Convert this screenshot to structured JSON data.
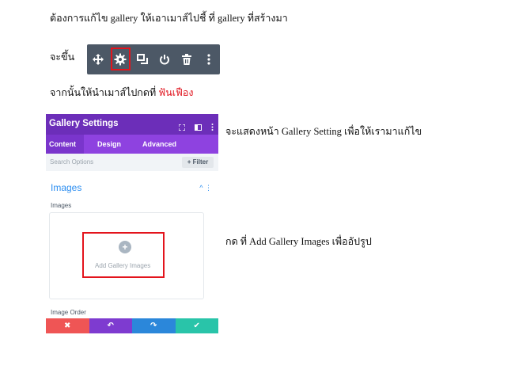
{
  "doc": {
    "line1": "ต้องการแก้ไข gallery ให้เอาเมาส์ไปชี้ ที่ gallery ที่สร้างมา",
    "line2": "จะขึ้น",
    "line3_prefix": "จากนั้นให้นำเมาส์ไปกดที่ ",
    "line3_highlight": "ฟันเฟือง",
    "line4": "จะแสดงหน้า Gallery Setting เพื่อให้เรามาแก้ไข",
    "line5": "กด ที่ Add Gallery Images เพื่ออัปรูป"
  },
  "toolbar": {
    "icons": [
      "move-icon",
      "gear-icon",
      "duplicate-icon",
      "power-icon",
      "trash-icon",
      "more-vertical-icon"
    ],
    "background": "#4c5866",
    "highlight_color": "#e3141c"
  },
  "panel": {
    "title": "Gallery Settings",
    "header_icons": [
      "expand-icon",
      "columns-icon",
      "more-vertical-icon"
    ],
    "tabs": [
      {
        "label": "Content",
        "active": true
      },
      {
        "label": "Design",
        "active": false
      },
      {
        "label": "Advanced",
        "active": false
      }
    ],
    "search_placeholder": "Search Options",
    "filter_label": "+ Filter",
    "section_title": "Images",
    "section_ctrl": "^ ⋮",
    "images_label": "Images",
    "plus_glyph": "+",
    "add_label": "Add Gallery Images",
    "image_order_label": "Image Order",
    "footer_buttons": [
      {
        "name": "cancel-button",
        "glyph": "✖",
        "color": "#ef5555"
      },
      {
        "name": "undo-button",
        "glyph": "↶",
        "color": "#7e3bd0"
      },
      {
        "name": "redo-button",
        "glyph": "↷",
        "color": "#2b87da"
      },
      {
        "name": "save-button",
        "glyph": "✔",
        "color": "#29c4a9"
      }
    ],
    "colors": {
      "header": "#6c2eb9",
      "tabs": "#8e42e0",
      "accent": "#2d8ef0"
    }
  }
}
